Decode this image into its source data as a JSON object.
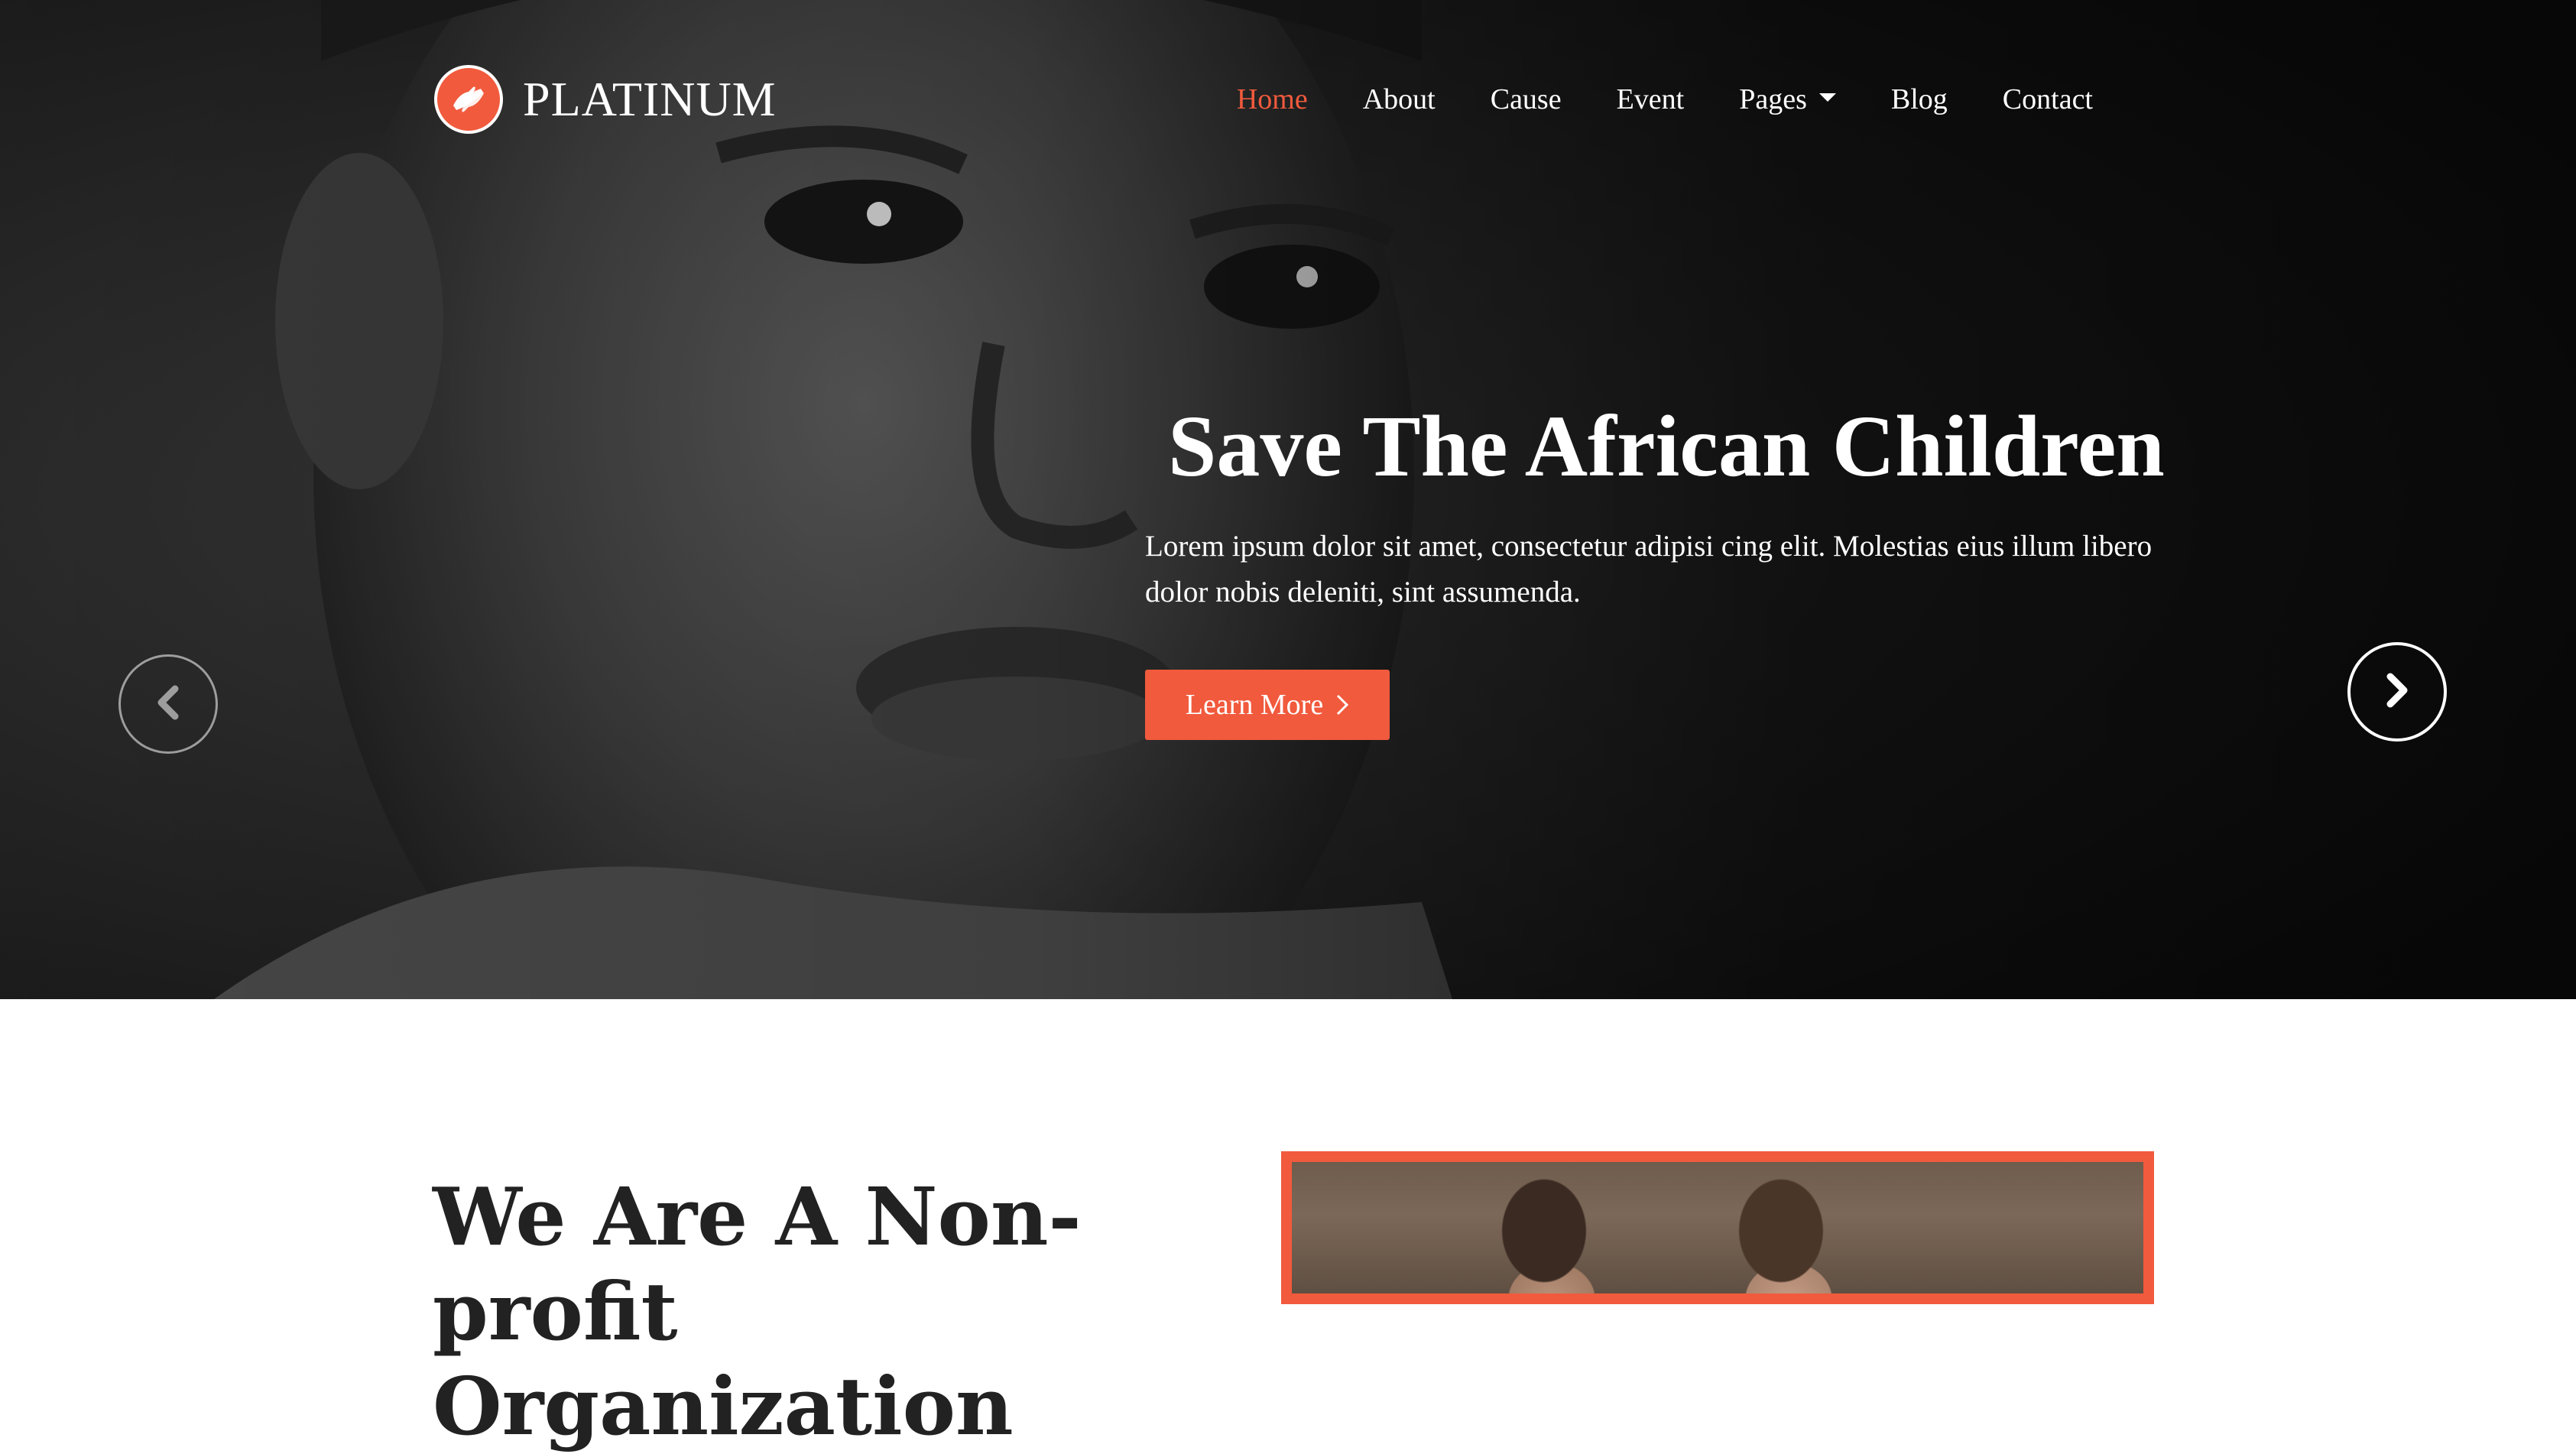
{
  "brand": {
    "name": "PLATINUM",
    "logo_icon": "helping-hands-icon",
    "accent_color": "#f15a3d"
  },
  "nav": {
    "items": [
      {
        "label": "Home",
        "active": true
      },
      {
        "label": "About",
        "active": false
      },
      {
        "label": "Cause",
        "active": false
      },
      {
        "label": "Event",
        "active": false
      },
      {
        "label": "Pages",
        "active": false,
        "dropdown": true
      },
      {
        "label": "Blog",
        "active": false
      },
      {
        "label": "Contact",
        "active": false
      }
    ]
  },
  "hero": {
    "title": "Save The African Children",
    "text": "Lorem ipsum dolor sit amet, consectetur adipisi cing elit. Molestias eius illum libero dolor nobis deleniti, sint assumenda.",
    "button_label": "Learn More",
    "button_icon": "chevron-right-icon",
    "prev_icon": "chevron-left-icon",
    "next_icon": "chevron-right-icon"
  },
  "about": {
    "title": "We Are A Non-profit Organization"
  }
}
